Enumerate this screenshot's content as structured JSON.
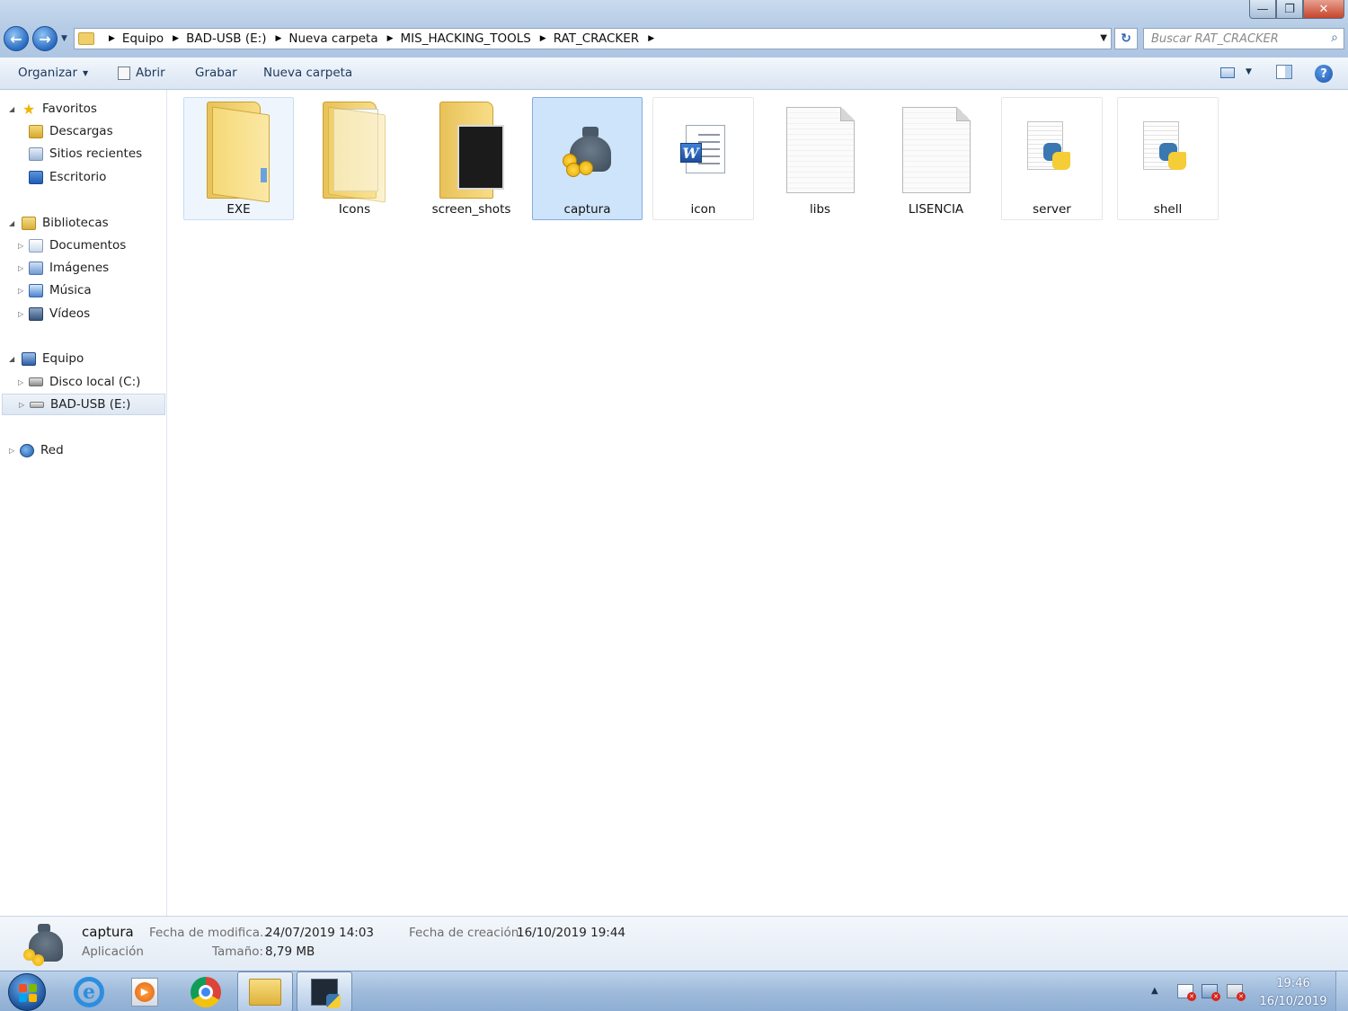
{
  "window": {
    "controls": {
      "minimize": "—",
      "maximize": "❐",
      "close": "✕"
    }
  },
  "address": {
    "breadcrumbs": [
      "Equipo",
      "BAD-USB (E:)",
      "Nueva carpeta",
      "MIS_HACKING_TOOLS",
      "RAT_CRACKER"
    ],
    "search_placeholder": "Buscar RAT_CRACKER"
  },
  "toolbar": {
    "organize": "Organizar",
    "open": "Abrir",
    "burn": "Grabar",
    "new_folder": "Nueva carpeta",
    "help": "?"
  },
  "nav": {
    "favorites": "Favoritos",
    "downloads": "Descargas",
    "recent": "Sitios recientes",
    "desktop": "Escritorio",
    "libraries": "Bibliotecas",
    "documents": "Documentos",
    "pictures": "Imágenes",
    "music": "Música",
    "videos": "Vídeos",
    "computer": "Equipo",
    "local_disk": "Disco local (C:)",
    "bad_usb": "BAD-USB (E:)",
    "network": "Red"
  },
  "files": [
    {
      "name": "EXE",
      "kind": "folder",
      "state": "hover"
    },
    {
      "name": "Icons",
      "kind": "folder-pages",
      "state": ""
    },
    {
      "name": "screen_shots",
      "kind": "folder-shots",
      "state": ""
    },
    {
      "name": "captura",
      "kind": "application",
      "state": "selected"
    },
    {
      "name": "icon",
      "kind": "word-document",
      "state": ""
    },
    {
      "name": "libs",
      "kind": "blank-document",
      "state": ""
    },
    {
      "name": "LISENCIA",
      "kind": "blank-document",
      "state": ""
    },
    {
      "name": "server",
      "kind": "python-script",
      "state": ""
    },
    {
      "name": "shell",
      "kind": "python-script",
      "state": ""
    }
  ],
  "details": {
    "name": "captura",
    "type": "Aplicación",
    "modified_label": "Fecha de modifica...",
    "modified_value": "24/07/2019 14:03",
    "size_label": "Tamaño:",
    "size_value": "8,79 MB",
    "created_label": "Fecha de creación:",
    "created_value": "16/10/2019 19:44"
  },
  "taskbar": {
    "time": "19:46",
    "date": "16/10/2019",
    "ie_glyph": "e",
    "play_glyph": "▶"
  },
  "colors": {
    "selection": "#cde4fa",
    "selection_border": "#84acdd",
    "folder": "#f5d977",
    "accent": "#2a6bc1"
  }
}
